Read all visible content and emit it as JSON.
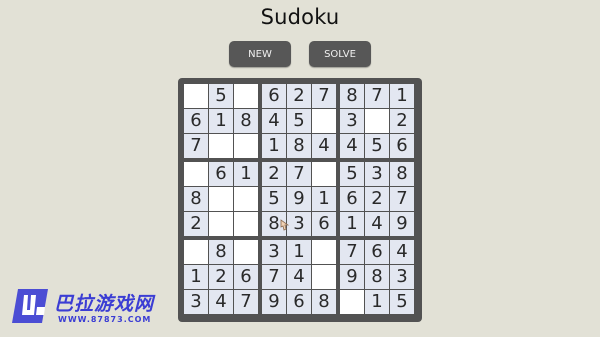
{
  "title": "Sudoku",
  "buttons": {
    "new_label": "NEW",
    "solve_label": "SOLVE"
  },
  "board": {
    "rows": [
      [
        "",
        "5",
        "",
        "6",
        "2",
        "7",
        "8",
        "7",
        "1"
      ],
      [
        "6",
        "1",
        "8",
        "4",
        "5",
        "",
        "3",
        "",
        "2"
      ],
      [
        "7",
        "",
        "",
        "1",
        "8",
        "4",
        "4",
        "5",
        "6"
      ],
      [
        "",
        "6",
        "1",
        "2",
        "7",
        "",
        "5",
        "3",
        "8"
      ],
      [
        "8",
        "",
        "",
        "5",
        "9",
        "1",
        "6",
        "2",
        "7"
      ],
      [
        "2",
        "",
        "",
        "8",
        "3",
        "6",
        "1",
        "4",
        "9"
      ],
      [
        "",
        "8",
        "",
        "3",
        "1",
        "",
        "7",
        "6",
        "4"
      ],
      [
        "1",
        "2",
        "6",
        "7",
        "4",
        "",
        "9",
        "8",
        "3"
      ],
      [
        "3",
        "4",
        "7",
        "9",
        "6",
        "8",
        "",
        "1",
        "5"
      ]
    ]
  },
  "colors": {
    "background": "#e2e1d6",
    "board_frame": "#525252",
    "given_cell": "#e3e7f1",
    "empty_cell": "#ffffff",
    "button": "#575757",
    "watermark": "#3b3dd4"
  },
  "watermark": {
    "text": "巴拉游戏网",
    "url": "WWW.87873.COM"
  }
}
